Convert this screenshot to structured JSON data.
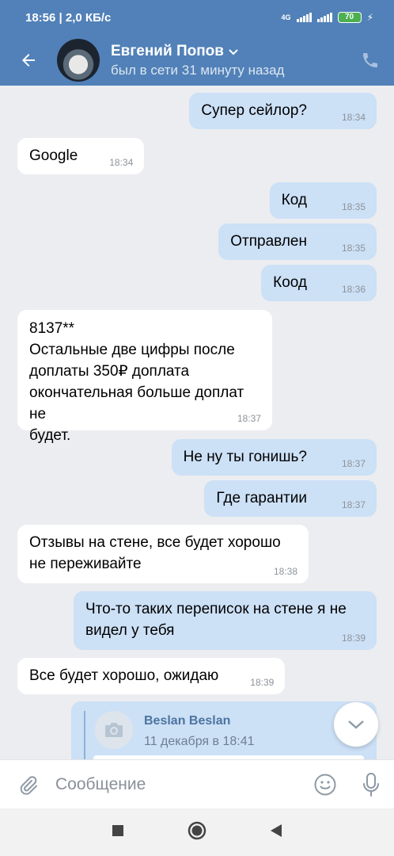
{
  "status_bar": {
    "time_speed": "18:56 | 2,0 КБ/с",
    "network": "4G",
    "battery": "70"
  },
  "header": {
    "contact_name": "Евгений Попов",
    "contact_status": "был в сети 31 минуту назад"
  },
  "messages": [
    {
      "dir": "out",
      "text": "Супер сейлор?",
      "time": "18:34"
    },
    {
      "dir": "in",
      "text": "Google",
      "time": "18:34"
    },
    {
      "dir": "out",
      "text": "Код",
      "time": "18:35"
    },
    {
      "dir": "out",
      "text": "Отправлен",
      "time": "18:35"
    },
    {
      "dir": "out",
      "text": "Коод",
      "time": "18:36"
    },
    {
      "dir": "in",
      "text": "8137**\nОстальные две цифры после\nдоплаты 350₽ доплата\nокончательная больше доплат не\nбудет.",
      "time": "18:37"
    },
    {
      "dir": "out",
      "text": "Не ну ты гонишь?",
      "time": "18:37"
    },
    {
      "dir": "out",
      "text": "Где гарантии",
      "time": "18:37"
    },
    {
      "dir": "in",
      "text": "Отзывы на стене, все будет хорошо\nне переживайте",
      "time": "18:38"
    },
    {
      "dir": "out",
      "text": "Что-то таких переписок на стене я не\nвидел у тебя",
      "time": "18:39"
    },
    {
      "dir": "in",
      "text": "Все будет хорошо, ожидаю",
      "time": "18:39"
    }
  ],
  "forwarded": {
    "name": "Beslan Beslan",
    "date": "11 декабря в 18:41"
  },
  "compose": {
    "placeholder": "Сообщение"
  },
  "colors": {
    "header": "#5181b8",
    "outgoing_bubble": "#cce0f6",
    "incoming_bubble": "#ffffff",
    "background": "#ebedf0"
  }
}
